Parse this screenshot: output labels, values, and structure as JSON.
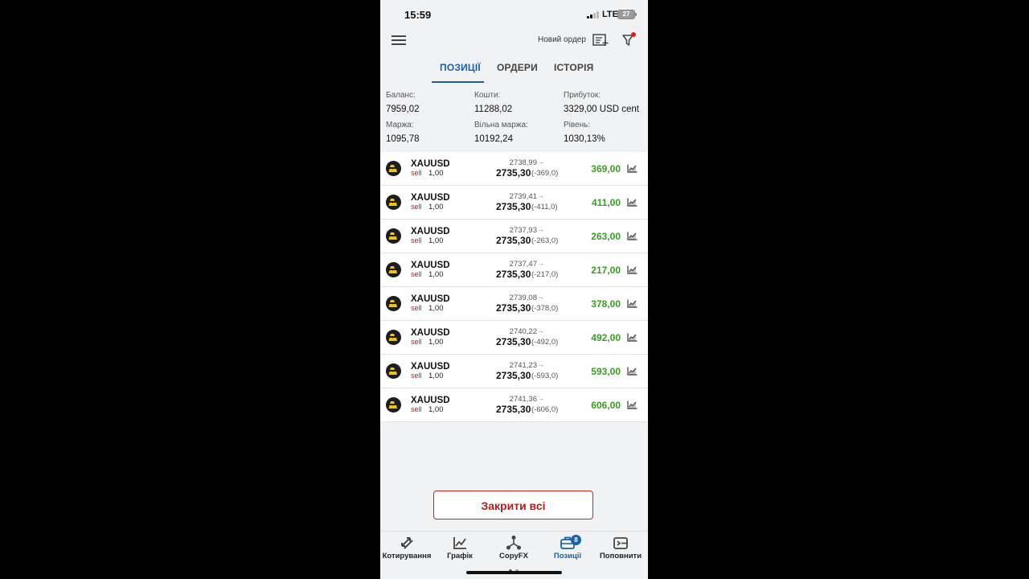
{
  "status": {
    "time": "15:59",
    "network": "LTE",
    "battery": "27"
  },
  "topbar": {
    "new_order": "Новий ордер"
  },
  "tabs": [
    "ПОЗИЦІЇ",
    "ОРДЕРИ",
    "ІСТОРІЯ"
  ],
  "summary": {
    "balance_label": "Баланс:",
    "balance": "7959,02",
    "funds_label": "Кошти:",
    "funds": "11288,02",
    "profit_label": "Прибуток:",
    "profit": "3329,00 USD cent",
    "margin_label": "Маржа:",
    "margin": "1095,78",
    "free_margin_label": "Вільна маржа:",
    "free_margin": "10192,24",
    "level_label": "Рівень:",
    "level": "1030,13%"
  },
  "positions": [
    {
      "symbol": "XAUUSD",
      "side": "sell",
      "volume": "1,00",
      "open": "2738,99",
      "current": "2735,30",
      "diff": "(-369,0)",
      "profit": "369,00"
    },
    {
      "symbol": "XAUUSD",
      "side": "sell",
      "volume": "1,00",
      "open": "2739,41",
      "current": "2735,30",
      "diff": "(-411,0)",
      "profit": "411,00"
    },
    {
      "symbol": "XAUUSD",
      "side": "sell",
      "volume": "1,00",
      "open": "2737,93",
      "current": "2735,30",
      "diff": "(-263,0)",
      "profit": "263,00"
    },
    {
      "symbol": "XAUUSD",
      "side": "sell",
      "volume": "1,00",
      "open": "2737,47",
      "current": "2735,30",
      "diff": "(-217,0)",
      "profit": "217,00"
    },
    {
      "symbol": "XAUUSD",
      "side": "sell",
      "volume": "1,00",
      "open": "2739,08",
      "current": "2735,30",
      "diff": "(-378,0)",
      "profit": "378,00"
    },
    {
      "symbol": "XAUUSD",
      "side": "sell",
      "volume": "1,00",
      "open": "2740,22",
      "current": "2735,30",
      "diff": "(-492,0)",
      "profit": "492,00"
    },
    {
      "symbol": "XAUUSD",
      "side": "sell",
      "volume": "1,00",
      "open": "2741,23",
      "current": "2735,30",
      "diff": "(-593,0)",
      "profit": "593,00"
    },
    {
      "symbol": "XAUUSD",
      "side": "sell",
      "volume": "1,00",
      "open": "2741,36",
      "current": "2735,30",
      "diff": "(-606,0)",
      "profit": "606,00"
    }
  ],
  "close_all": "Закрити всі",
  "nav": [
    {
      "label": "Котирування",
      "icon": "quotes-icon"
    },
    {
      "label": "Графік",
      "icon": "chart-icon"
    },
    {
      "label": "CopyFX",
      "icon": "copyfx-icon"
    },
    {
      "label": "Позиції",
      "icon": "positions-icon",
      "badge": "8"
    },
    {
      "label": "Поповнити",
      "icon": "deposit-icon"
    }
  ],
  "colors": {
    "accent": "#1a5fa8",
    "profit": "#3a9d23",
    "sell": "#c0181f",
    "close": "#b71c1c"
  }
}
